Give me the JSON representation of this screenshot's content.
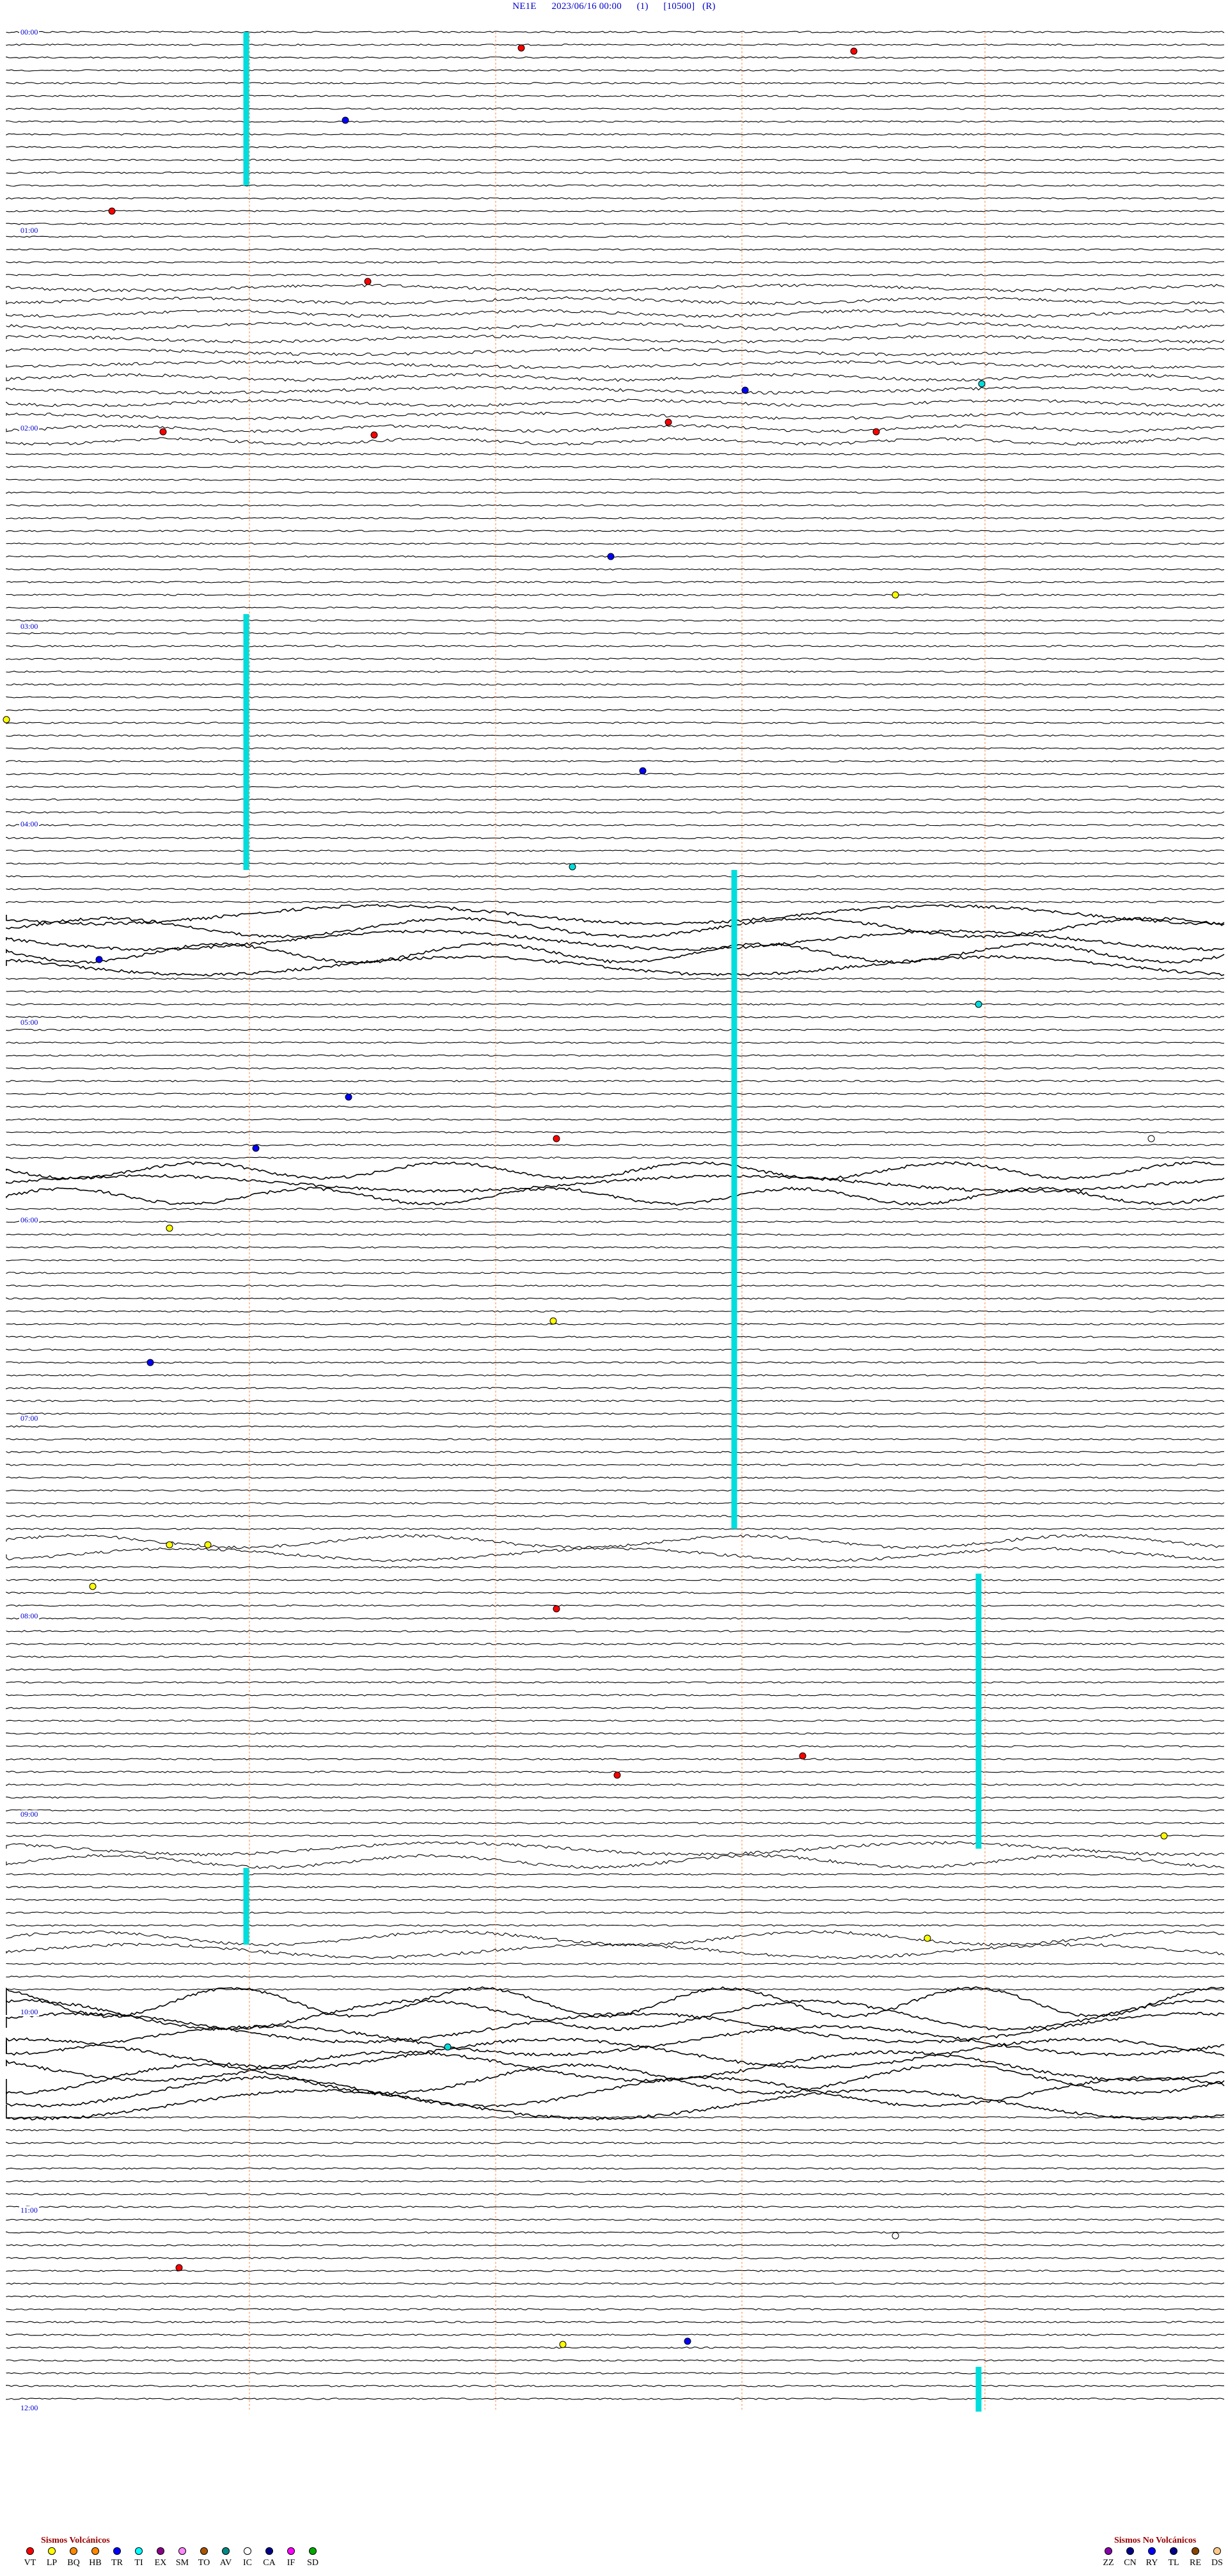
{
  "header": {
    "station": "NE1E",
    "datetime": "2023/06/16 00:00",
    "channel": "(1)",
    "scale": "[10500]",
    "mode": "(R)",
    "title_line": "NE1E      2023/06/16 00:00      (1)      [10500]   (R)"
  },
  "hour_labels": [
    "00:00",
    "01:00",
    "02:00",
    "03:00",
    "04:00",
    "05:00",
    "06:00",
    "07:00",
    "08:00",
    "09:00",
    "10:00",
    "11:00",
    "12:00"
  ],
  "trace_colors": {
    "trace": "#000000",
    "tick": "#ff8844",
    "saturation": "#00dddd",
    "label": "#0000cc"
  },
  "legend": {
    "volcanic_title": "Sismos Volcánicos",
    "volcanic": [
      {
        "code": "VT",
        "color": "#ff0000"
      },
      {
        "code": "LP",
        "color": "#ffff00"
      },
      {
        "code": "BQ",
        "color": "#ff8800"
      },
      {
        "code": "HB",
        "color": "#ff8800"
      },
      {
        "code": "TR",
        "color": "#0000ff"
      },
      {
        "code": "TI",
        "color": "#00ffff"
      },
      {
        "code": "EX",
        "color": "#880088"
      },
      {
        "code": "SM",
        "color": "#ff88ff"
      },
      {
        "code": "TO",
        "color": "#aa5500"
      },
      {
        "code": "AV",
        "color": "#008888"
      },
      {
        "code": "IC",
        "color": "#ffffff"
      },
      {
        "code": "CA",
        "color": "#000088"
      },
      {
        "code": "IF",
        "color": "#ff00ff"
      },
      {
        "code": "SD",
        "color": "#00aa00"
      }
    ],
    "nonvolcanic_title": "Sismos No Volcánicos",
    "nonvolcanic": [
      {
        "code": "ZZ",
        "color": "#8800aa"
      },
      {
        "code": "CN",
        "color": "#000088"
      },
      {
        "code": "RY",
        "color": "#0000ff"
      },
      {
        "code": "TL",
        "color": "#000088"
      },
      {
        "code": "RE",
        "color": "#884400"
      },
      {
        "code": "DS",
        "color": "#ffcc88"
      }
    ]
  }
}
